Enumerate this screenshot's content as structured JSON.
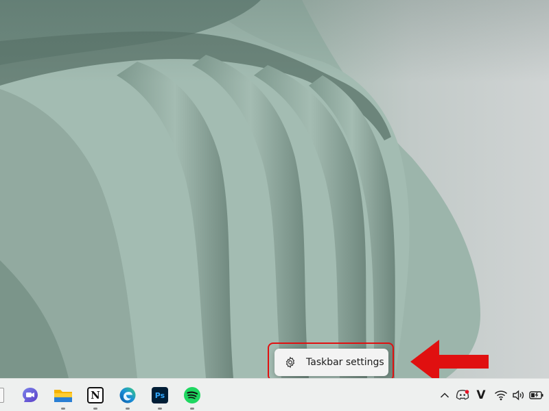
{
  "context_menu": {
    "items": [
      {
        "label": "Taskbar settings",
        "icon": "gear-icon"
      }
    ]
  },
  "taskbar": {
    "apps": [
      {
        "name": "teams-chat",
        "icon": "teams-chat-icon"
      },
      {
        "name": "file-explorer",
        "icon": "folder-icon"
      },
      {
        "name": "notion",
        "icon": "notion-icon",
        "glyph": "N"
      },
      {
        "name": "edge",
        "icon": "edge-icon"
      },
      {
        "name": "photoshop",
        "icon": "photoshop-icon",
        "glyph": "Ps"
      },
      {
        "name": "spotify",
        "icon": "spotify-icon"
      }
    ],
    "tray": [
      {
        "name": "show-hidden-icons",
        "icon": "chevron-up-icon"
      },
      {
        "name": "discord",
        "icon": "discord-icon"
      },
      {
        "name": "vpn",
        "icon": "v-logo-icon",
        "glyph": "V"
      },
      {
        "name": "wifi",
        "icon": "wifi-icon"
      },
      {
        "name": "volume",
        "icon": "speaker-icon"
      },
      {
        "name": "battery",
        "icon": "battery-charging-icon"
      }
    ]
  },
  "colors": {
    "highlight": "#e01010",
    "photoshop_bg": "#001e36",
    "photoshop_fg": "#31a8ff",
    "spotify": "#1ed760",
    "teams": "#5b5fc7"
  }
}
